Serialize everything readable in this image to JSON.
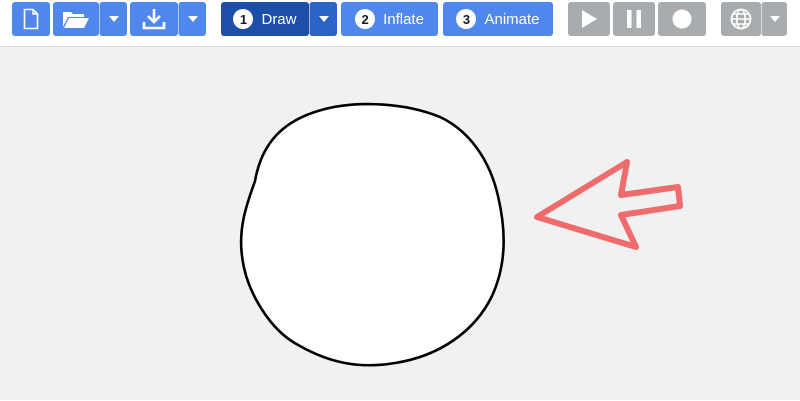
{
  "toolbar": {
    "steps": [
      {
        "number": "1",
        "label": "Draw"
      },
      {
        "number": "2",
        "label": "Inflate"
      },
      {
        "number": "3",
        "label": "Animate"
      }
    ],
    "icons": {
      "new": "new-file-icon",
      "open": "folder-open-icon",
      "download": "download-icon",
      "play": "play-icon",
      "pause": "pause-icon",
      "record": "record-icon",
      "language": "globe-icon",
      "dropdown": "caret-down-icon"
    },
    "active_step": "Draw"
  },
  "canvas": {
    "shapes": [
      "hand-drawn-circle",
      "annotation-arrow"
    ]
  },
  "colors": {
    "button": "#4f87ec",
    "button_selected": "#1d4fa8",
    "button_disabled": "#a9acaf",
    "canvas_bg": "#f1f1f1",
    "drawing_fill": "#ffffff",
    "drawing_stroke": "#000000",
    "arrow": "#f06b6b"
  }
}
